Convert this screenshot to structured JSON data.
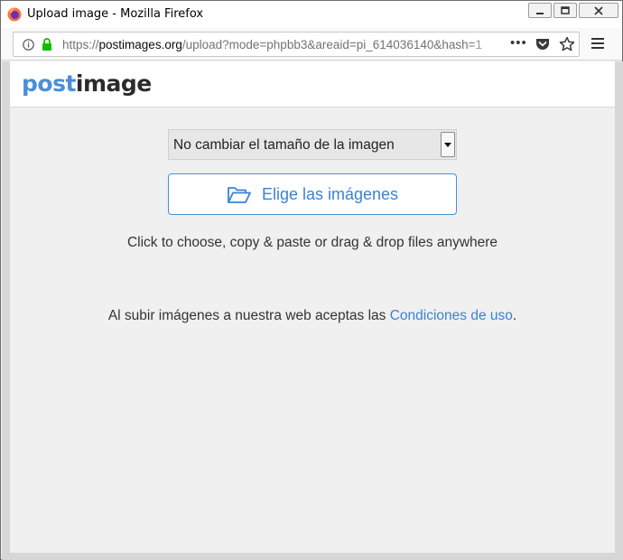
{
  "window": {
    "title": "Upload image - Mozilla Firefox"
  },
  "urlbar": {
    "url_prefix": "https://",
    "url_domain": "postimages.org",
    "url_path": "/upload?mode=phpbb3&areaid=pi_614036140&hash=1",
    "overflow_label": "•••"
  },
  "site": {
    "logo_part1": "post",
    "logo_part2": "image"
  },
  "upload": {
    "resize_select_value": "No cambiar el tamaño de la imagen",
    "choose_button_label": "Elige las imágenes",
    "hint_text": "Click to choose, copy & paste or drag & drop files anywhere",
    "terms_prefix": "Al subir imágenes a nuestra web aceptas las ",
    "terms_link": "Condiciones de uso",
    "terms_suffix": "."
  },
  "colors": {
    "accent": "#3b83d1",
    "logo_blue": "#4a8fd8",
    "lock_green": "#12bc00"
  }
}
